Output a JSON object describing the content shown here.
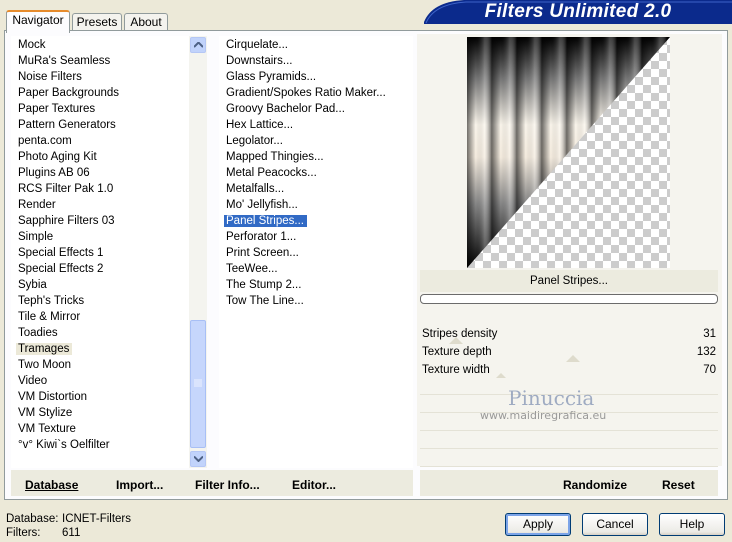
{
  "banner": {
    "title": "Filters Unlimited 2.0"
  },
  "tabs": [
    {
      "label": "Navigator"
    },
    {
      "label": "Presets"
    },
    {
      "label": "About"
    }
  ],
  "categories": [
    "Mock",
    "MuRa's Seamless",
    "Noise Filters",
    "Paper Backgrounds",
    "Paper Textures",
    "Pattern Generators",
    "penta.com",
    "Photo Aging Kit",
    "Plugins AB 06",
    "RCS Filter Pak 1.0",
    "Render",
    "Sapphire Filters 03",
    "Simple",
    "Special Effects 1",
    "Special Effects 2",
    "Sybia",
    "Teph's Tricks",
    "Tile & Mirror",
    "Toadies",
    "Tramages",
    "Two Moon",
    "Video",
    "VM Distortion",
    "VM Stylize",
    "VM Texture",
    "°v° Kiwi`s Oelfilter"
  ],
  "selected_category": "Tramages",
  "filters": [
    "Cirquelate...",
    "Downstairs...",
    "Glass Pyramids...",
    "Gradient/Spokes Ratio Maker...",
    "Groovy Bachelor Pad...",
    "Hex Lattice...",
    "Legolator...",
    "Mapped Thingies...",
    "Metal Peacocks...",
    "Metalfalls...",
    "Mo' Jellyfish...",
    "Panel Stripes...",
    "Perforator 1...",
    "Print Screen...",
    "TeeWee...",
    "The Stump 2...",
    "Tow The Line..."
  ],
  "selected_filter": "Panel Stripes...",
  "preview": {
    "caption": "Panel Stripes..."
  },
  "params": [
    {
      "label": "Stripes density",
      "value": "31"
    },
    {
      "label": "Texture depth",
      "value": "132"
    },
    {
      "label": "Texture width",
      "value": "70"
    }
  ],
  "watermark": {
    "name": "Pinuccia",
    "site": "www.maidiregrafica.eu"
  },
  "toolbar": {
    "database": "Database",
    "import": "Import...",
    "filter_info": "Filter Info...",
    "editor": "Editor...",
    "randomize": "Randomize",
    "reset": "Reset"
  },
  "status": {
    "database_label": "Database:",
    "database_value": "ICNET-Filters",
    "filters_label": "Filters:",
    "filters_value": "611"
  },
  "buttons": {
    "apply": "Apply",
    "cancel": "Cancel",
    "help": "Help"
  },
  "colors": {
    "banner": "#0b2a8c",
    "selection": "#316ac5",
    "accent_tab": "#e68b2c"
  }
}
